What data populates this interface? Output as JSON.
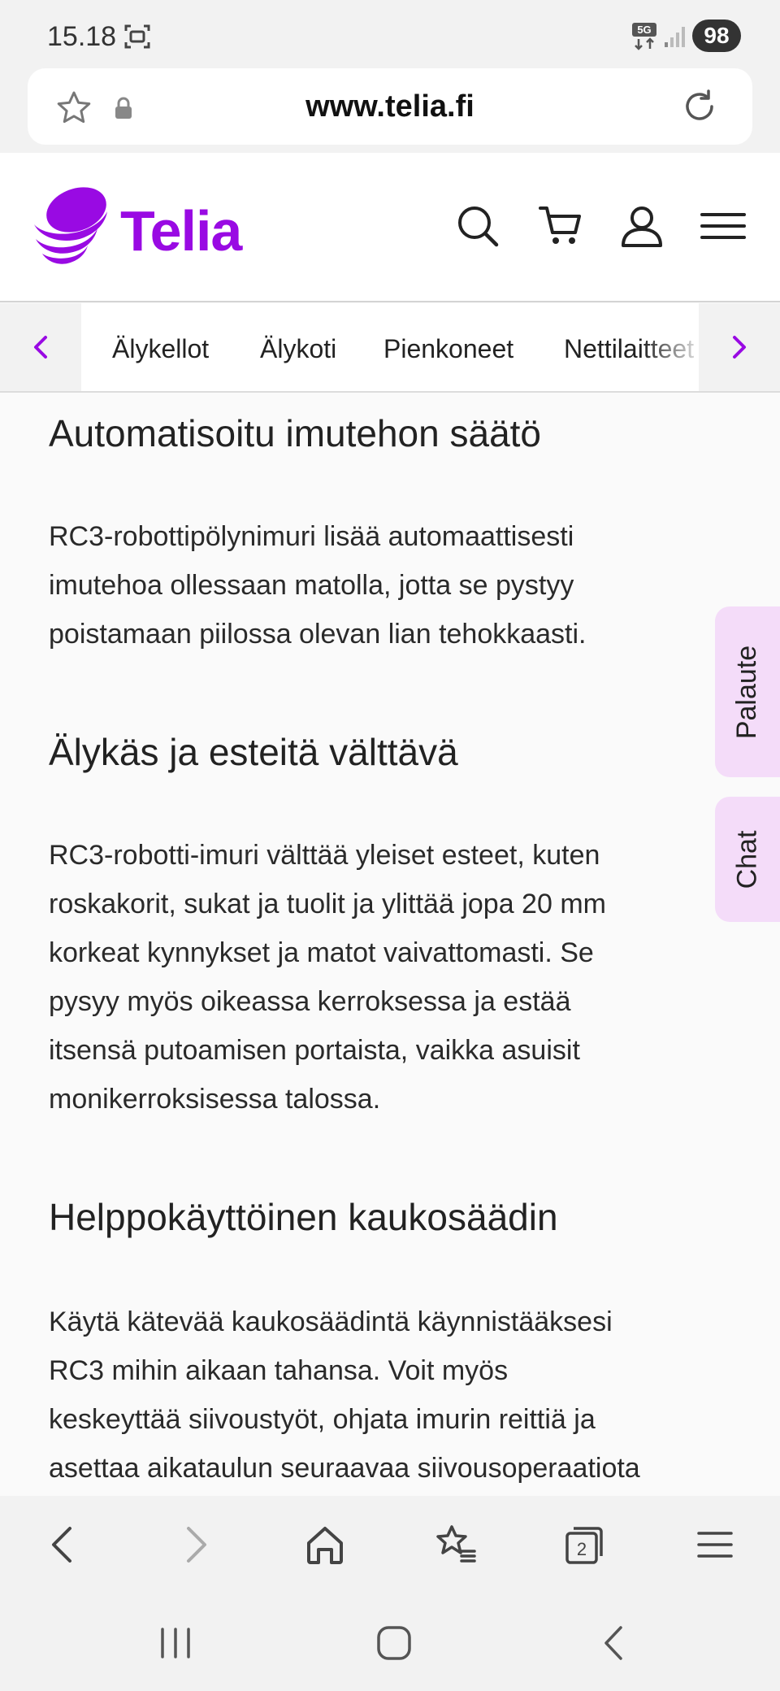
{
  "status_bar": {
    "time": "15.18",
    "network_label": "5G",
    "battery": "98"
  },
  "browser": {
    "url": "www.telia.fi",
    "tab_count": "2"
  },
  "site": {
    "brand": "Telia",
    "brand_color": "#990AE3"
  },
  "category_nav": {
    "items": [
      "Älykellot",
      "Älykoti",
      "Pienkoneet",
      "Nettilaitteet"
    ]
  },
  "sections": [
    {
      "heading": "Automatisoitu imutehon säätö",
      "lines": [
        "RC3-robottipölynimuri lisää automaattisesti",
        "imutehoa ollessaan matolla, jotta se pystyy",
        "poistamaan piilossa olevan lian tehokkaasti."
      ]
    },
    {
      "heading": "Älykäs ja esteitä välttävä",
      "lines": [
        "RC3-robotti-imuri välttää yleiset esteet, kuten",
        "roskakorit, sukat ja tuolit ja ylittää jopa 20 mm",
        "korkeat kynnykset ja matot vaivattomasti. Se",
        "pysyy myös oikeassa kerroksessa ja estää",
        "itsensä putoamisen portaista, vaikka asuisit",
        "monikerroksisessa talossa."
      ]
    },
    {
      "heading": "Helppokäyttöinen kaukosäädin",
      "lines": [
        "Käytä kätevää kaukosäädintä käynnistääksesi",
        "RC3 mihin aikaan tahansa. Voit myös",
        "keskeyttää siivoustyöt, ohjata imurin reittiä ja",
        "asettaa aikataulun seuraavaa siivousoperaatiota"
      ]
    }
  ],
  "side_tabs": {
    "feedback": "Palaute",
    "chat": "Chat"
  }
}
